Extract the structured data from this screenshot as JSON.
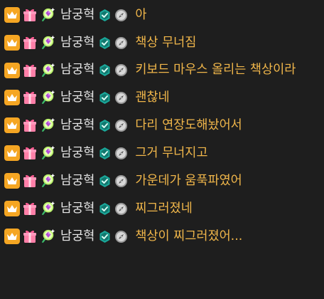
{
  "theme": {
    "background": "#1e1e1e",
    "username_color": "#e6e6e6",
    "message_color": "#f0b64a",
    "crown_bg": "#f5a623",
    "crown_color": "#ffffff",
    "teal_badge": "#1aa89a"
  },
  "icons": {
    "crown": "crown-icon",
    "gift": "gift-icon",
    "gem": "gem-icon",
    "verified": "verified-icon",
    "compass": "compass-icon"
  },
  "messages": [
    {
      "user": "남궁혁",
      "text": "아"
    },
    {
      "user": "남궁혁",
      "text": "책상 무너짐"
    },
    {
      "user": "남궁혁",
      "text": "키보드 마우스 올리는 책상이라"
    },
    {
      "user": "남궁혁",
      "text": "괜찮네"
    },
    {
      "user": "남궁혁",
      "text": "다리 연장도해놨어서"
    },
    {
      "user": "남궁혁",
      "text": "그거 무너지고"
    },
    {
      "user": "남궁혁",
      "text": "가운데가 움푹파였어"
    },
    {
      "user": "남궁혁",
      "text": "찌그러졌네"
    },
    {
      "user": "남궁혁",
      "text": "책상이 찌그러졌어..."
    }
  ]
}
